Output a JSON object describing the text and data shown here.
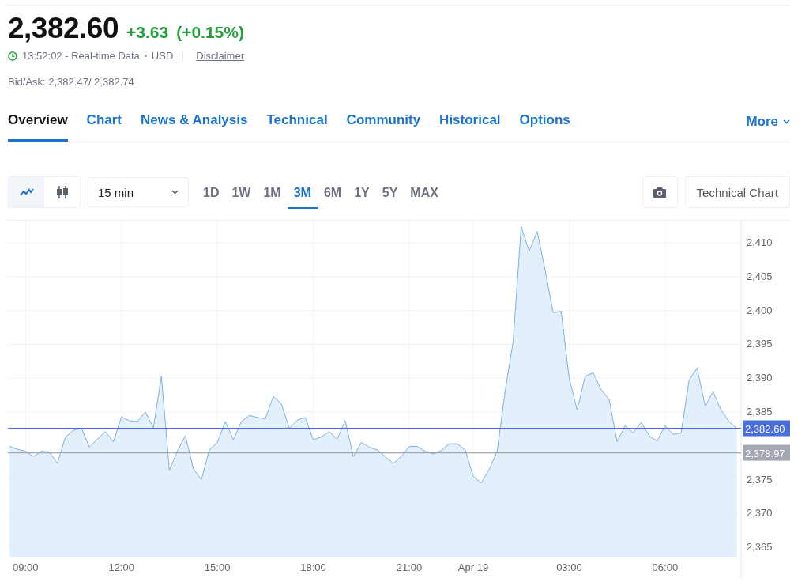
{
  "quote": {
    "price": "2,382.60",
    "change": "+3.63",
    "change_percent": "(+0.15%)",
    "time": "13:52:02 - Real-time Data",
    "currency": "USD",
    "disclaimer": "Disclaimer",
    "bid_ask": "Bid/Ask: 2,382.47/ 2,382.74"
  },
  "tabs": [
    {
      "label": "Overview",
      "selected": true
    },
    {
      "label": "Chart",
      "selected": false
    },
    {
      "label": "News & Analysis",
      "selected": false
    },
    {
      "label": "Technical",
      "selected": false
    },
    {
      "label": "Community",
      "selected": false
    },
    {
      "label": "Historical",
      "selected": false
    },
    {
      "label": "Options",
      "selected": false
    }
  ],
  "more": {
    "label": "More"
  },
  "chart_types": [
    {
      "kind": "line",
      "selected": true
    },
    {
      "kind": "candles",
      "selected": false
    }
  ],
  "interval": {
    "value": "15 min"
  },
  "ranges": [
    {
      "label": "1D",
      "selected": false
    },
    {
      "label": "1W",
      "selected": false
    },
    {
      "label": "1M",
      "selected": false
    },
    {
      "label": "3M",
      "selected": true
    },
    {
      "label": "6M",
      "selected": false
    },
    {
      "label": "1Y",
      "selected": false
    },
    {
      "label": "5Y",
      "selected": false
    },
    {
      "label": "MAX",
      "selected": false
    }
  ],
  "technical_chart": {
    "label": "Technical Chart"
  },
  "chart_data": {
    "type": "area",
    "categories": [
      null,
      null,
      "09:00",
      null,
      null,
      null,
      null,
      null,
      null,
      null,
      null,
      null,
      null,
      null,
      "12:00",
      null,
      null,
      null,
      null,
      null,
      null,
      null,
      null,
      null,
      null,
      null,
      "15:00",
      null,
      null,
      null,
      null,
      null,
      null,
      null,
      null,
      null,
      null,
      null,
      "18:00",
      null,
      null,
      null,
      null,
      null,
      null,
      null,
      null,
      null,
      null,
      null,
      "21:00",
      null,
      null,
      null,
      null,
      null,
      null,
      null,
      "Apr 19",
      null,
      null,
      null,
      null,
      null,
      null,
      null,
      null,
      null,
      null,
      null,
      "03:00",
      null,
      null,
      null,
      null,
      null,
      null,
      null,
      null,
      null,
      null,
      null,
      "06:00",
      null,
      null,
      null,
      null,
      null,
      null,
      null,
      null,
      null
    ],
    "values": [
      2379.9,
      2379.5,
      2379.2,
      2378.4,
      2379.2,
      2379.1,
      2377.4,
      2381.3,
      2382.3,
      2382.6,
      2379.8,
      2381,
      2382.1,
      2380.6,
      2384.3,
      2383.7,
      2383.6,
      2385,
      2382.7,
      2390.3,
      2376.4,
      2379.2,
      2381.5,
      2376.6,
      2375,
      2379.4,
      2380.5,
      2383.6,
      2380.9,
      2383.6,
      2384.5,
      2384.2,
      2384,
      2387.3,
      2386.2,
      2382.6,
      2383.8,
      2384.2,
      2380.9,
      2381.3,
      2382.1,
      2381,
      2383.7,
      2378.4,
      2380.5,
      2379.8,
      2379.4,
      2378.4,
      2377.4,
      2378.4,
      2379.9,
      2379.9,
      2379.2,
      2378.8,
      2379.3,
      2380.3,
      2380.3,
      2379.4,
      2375.5,
      2374.5,
      2376.5,
      2379.2,
      2388.2,
      2395.5,
      2412.4,
      2408.8,
      2411.7,
      2405.9,
      2399.7,
      2399.9,
      2390,
      2385.3,
      2390.3,
      2390.8,
      2388.3,
      2386.9,
      2380.6,
      2383,
      2381.9,
      2383.5,
      2381.5,
      2380.7,
      2383,
      2381.7,
      2381.9,
      2389.7,
      2391.5,
      2385.9,
      2388,
      2385.3,
      2383.6,
      2382.6
    ],
    "ylim": [
      2363.6,
      2413.3
    ],
    "yticks": [
      {
        "value": 2365,
        "label": "2,365"
      },
      {
        "value": 2370,
        "label": "2,370"
      },
      {
        "value": 2375,
        "label": "2,375"
      },
      {
        "value": 2385,
        "label": "2,385"
      },
      {
        "value": 2390,
        "label": "2,390"
      },
      {
        "value": 2395,
        "label": "2,395"
      },
      {
        "value": 2400,
        "label": "2,400"
      },
      {
        "value": 2405,
        "label": "2,405"
      },
      {
        "value": 2410,
        "label": "2,410"
      }
    ],
    "grid": true,
    "ref_lines": [
      {
        "axis": "y",
        "value": 2382.6,
        "label": "2,382.60",
        "color": "#4a6fdc"
      },
      {
        "axis": "y",
        "value": 2378.97,
        "label": "2,378.97",
        "color": "#a3a8b0"
      }
    ]
  }
}
